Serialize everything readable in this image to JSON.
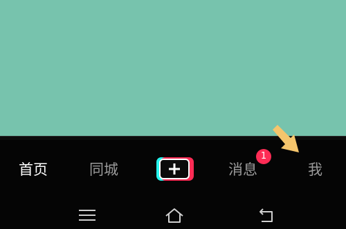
{
  "tab_bar": {
    "tabs": [
      {
        "label": "首页",
        "active": true
      },
      {
        "label": "同城",
        "active": false
      },
      {
        "label": "消息",
        "active": false
      },
      {
        "label": "我",
        "active": false
      }
    ],
    "create_button": {
      "icon": "plus-icon"
    },
    "messages_badge": "1"
  },
  "system_nav": {
    "buttons": [
      "menu-icon",
      "home-icon",
      "back-icon"
    ]
  },
  "annotation": {
    "icon": "arrow-icon",
    "color": "#f5c56c",
    "points_to": "我"
  },
  "colors": {
    "content_background": "#77c3ad",
    "bar_background": "#050505",
    "active_text": "#ffffff",
    "inactive_text": "#9a9a9a",
    "accent_red": "#fe2c55",
    "accent_cyan": "#25f4ee"
  }
}
